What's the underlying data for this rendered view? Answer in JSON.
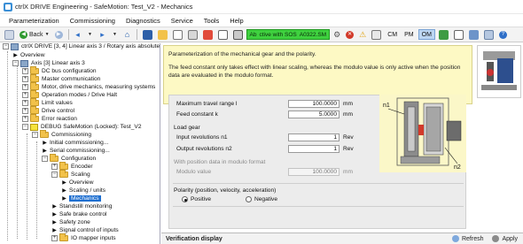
{
  "window": {
    "title": "ctrlX DRIVE Engineering - SafeMotion: Test_V2 - Mechanics"
  },
  "menu": [
    "Parameterization",
    "Commissioning",
    "Diagnostics",
    "Service",
    "Tools",
    "Help"
  ],
  "toolbar": {
    "back_label": "Back",
    "status_left": "Ab",
    "status_text": "ctive with SOS",
    "status_code": "A0322.SM",
    "modes": [
      "CM",
      "PM",
      "OM"
    ],
    "active_mode": "OM",
    "status_color": "#3fd13f"
  },
  "tree": {
    "root": "ctrlX DRIVE [3, 4] Linear axis 3 / Rotary axis absolute",
    "items": [
      "Overview",
      "Axis [3] Linear axis 3",
      "DC bus configuration",
      "Master communication",
      "Motor, drive mechanics, measuring systems",
      "Operation modes / Drive Halt",
      "Limit values",
      "Drive control",
      "Error reaction",
      "DEBUG SafeMotion (Locked): Test_V2",
      "Commissioning",
      "Initial commissioning...",
      "Serial commissioning...",
      "Configuration",
      "Encoder",
      "Scaling",
      "Overview",
      "Scaling / units",
      "Mechanics",
      "Standstill monitoring",
      "Safe brake control",
      "Safety zone",
      "Signal control of inputs",
      "IO mapper inputs"
    ]
  },
  "info": {
    "line1": "Parameterization of the mechanical gear and the polarity.",
    "line2": "The feed constant only takes effect with linear scaling, whereas the modulo value is only active when the position data are evaluated in the modulo format."
  },
  "params": {
    "max_travel_label": "Maximum travel range l",
    "max_travel_value": "100.0000",
    "max_travel_unit": "mm",
    "feed_label": "Feed constant k",
    "feed_value": "5.0000",
    "feed_unit": "mm",
    "load_gear_title": "Load gear",
    "input_rev_label": "Input revolutions n1",
    "input_rev_value": "1",
    "input_rev_unit": "Rev",
    "output_rev_label": "Output revolutions n2",
    "output_rev_value": "1",
    "output_rev_unit": "Rev",
    "modulo_title": "With position data in modulo format",
    "modulo_label": "Modulo value",
    "modulo_value": "100.0000",
    "modulo_unit": "mm",
    "polarity_title": "Polarity (position, velocity, acceleration)",
    "polarity_positive": "Positive",
    "polarity_negative": "Negative",
    "polarity_selected": "Positive"
  },
  "diagram": {
    "label_n1": "n1",
    "label_n2": "n2"
  },
  "verification": {
    "title": "Verification display",
    "refresh_label": "Refresh",
    "apply_label": "Apply"
  }
}
